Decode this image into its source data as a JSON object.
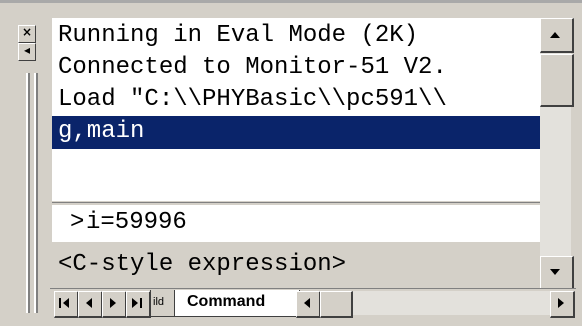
{
  "window": {
    "close_glyph": "×",
    "side_arrow": "◂"
  },
  "output": {
    "lines": [
      "Running in Eval Mode (2K)",
      "Connected to Monitor-51 V2.",
      "Load \"C:\\\\PHYBasic\\\\pc591\\\\",
      "g,main"
    ],
    "selected_line_index": 3
  },
  "command": {
    "prompt": ">",
    "value": "i=59996",
    "hint": "<C-style expression>"
  },
  "tabs": {
    "partial_label": "ild",
    "active_label": "Command"
  },
  "colors": {
    "selection_bg": "#0a246a",
    "selection_fg": "#ffffff",
    "face": "#d4d0c8"
  },
  "icons": {
    "scroll_up": "triangle-up-icon",
    "scroll_down": "triangle-down-icon",
    "first": "first-tab-icon",
    "prev": "previous-tab-icon",
    "next": "next-tab-icon",
    "last": "last-tab-icon",
    "hleft": "scroll-left-icon",
    "hright": "scroll-right-icon"
  }
}
